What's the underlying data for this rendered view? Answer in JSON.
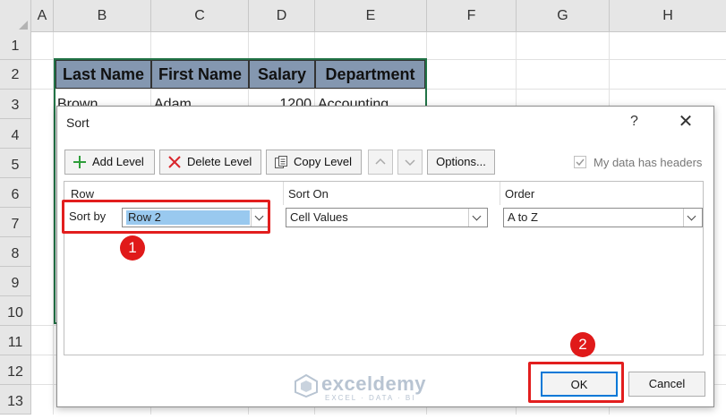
{
  "sheet": {
    "columns": [
      "A",
      "B",
      "C",
      "D",
      "E",
      "F",
      "G",
      "H"
    ],
    "rows": [
      "1",
      "2",
      "3",
      "4",
      "5",
      "6",
      "7",
      "8",
      "9",
      "10",
      "11",
      "12",
      "13"
    ],
    "headers": [
      "Last Name",
      "First Name",
      "Salary",
      "Department"
    ],
    "row3_partial": [
      "Brown",
      "Adam",
      "1200",
      "Accounting"
    ]
  },
  "dialog": {
    "title": "Sort",
    "help": "?",
    "toolbar": {
      "add_level": "Add Level",
      "delete_level": "Delete Level",
      "copy_level": "Copy Level",
      "options": "Options...",
      "my_data_has_headers": "My data has headers"
    },
    "list": {
      "col_row": "Row",
      "col_sort_on": "Sort On",
      "col_order": "Order",
      "sort_by_label": "Sort by",
      "sort_by_value": "Row 2",
      "sort_on_value": "Cell Values",
      "order_value": "A to Z"
    },
    "ok": "OK",
    "cancel": "Cancel"
  },
  "annotations": {
    "step1": "1",
    "step2": "2"
  },
  "watermark": {
    "name": "exceldemy",
    "tagline": "EXCEL · DATA · BI"
  },
  "colors": {
    "accent_red": "#e01a1a",
    "header_fill": "#8497b0",
    "selection_green": "#217346"
  }
}
